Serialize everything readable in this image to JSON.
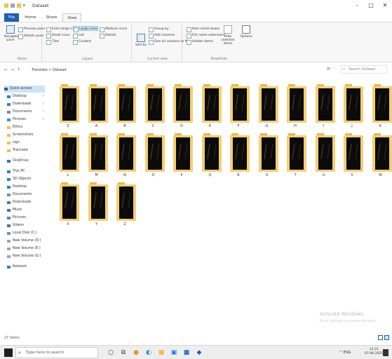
{
  "window": {
    "title": "Dataset",
    "controls": [
      "–",
      "□",
      "✕"
    ]
  },
  "ribbon": {
    "tabs": [
      "File",
      "Home",
      "Share",
      "View"
    ],
    "active_tab": "View",
    "groups": {
      "panes": {
        "name": "Panes",
        "items": [
          "Navigation pane",
          "Preview pane",
          "Details pane"
        ]
      },
      "layout": {
        "name": "Layout",
        "items": [
          "Extra large icons",
          "Large icons",
          "Medium icons",
          "Small icons",
          "List",
          "Details",
          "Tiles",
          "Content"
        ],
        "selected": "Large icons"
      },
      "current_view": {
        "name": "Current view",
        "sort_label": "Sort by",
        "items": [
          "Group by",
          "Add columns",
          "Size all columns to fit"
        ]
      },
      "show_hide": {
        "name": "Show/hide",
        "items": [
          "Item check boxes",
          "File name extensions",
          "Hidden items"
        ],
        "hide_selected": "Hide selected items",
        "options": "Options"
      }
    }
  },
  "address": {
    "path": "Translate > Dataset",
    "search_placeholder": "Search Dataset"
  },
  "nav": {
    "items": [
      {
        "label": "Quick access",
        "color": "#1a5fb4",
        "selected": true
      },
      {
        "label": "Desktop",
        "color": "#2b7fd6",
        "pinned": true
      },
      {
        "label": "Downloads",
        "color": "#2b7fd6",
        "pinned": true
      },
      {
        "label": "Documents",
        "color": "#7b8aa0",
        "pinned": true
      },
      {
        "label": "Pictures",
        "color": "#3a8fd8",
        "pinned": true
      },
      {
        "label": "Ethics",
        "color": "#f0c24e"
      },
      {
        "label": "Screenshots",
        "color": "#f0c24e"
      },
      {
        "label": "sign",
        "color": "#f0c24e"
      },
      {
        "label": "Translate",
        "color": "#f0c24e"
      },
      {
        "label": "OneDrive",
        "color": "#1a73e8",
        "gap": true
      },
      {
        "label": "This PC",
        "color": "#2b7fd6",
        "gap": true
      },
      {
        "label": "3D Objects",
        "color": "#2b7fd6"
      },
      {
        "label": "Desktop",
        "color": "#2b7fd6"
      },
      {
        "label": "Documents",
        "color": "#7b8aa0"
      },
      {
        "label": "Downloads",
        "color": "#2b7fd6"
      },
      {
        "label": "Music",
        "color": "#4a6fa5"
      },
      {
        "label": "Pictures",
        "color": "#3a8fd8"
      },
      {
        "label": "Videos",
        "color": "#4a6fa5"
      },
      {
        "label": "Local Disk (C:)",
        "color": "#7b8aa0"
      },
      {
        "label": "New Volume (D:)",
        "color": "#9aa4b0"
      },
      {
        "label": "New Volume (E:)",
        "color": "#9aa4b0"
      },
      {
        "label": "New Volume (G:)",
        "color": "#9aa4b0"
      },
      {
        "label": "Network",
        "color": "#2b7fd6",
        "gap": true
      }
    ]
  },
  "folders": [
    "Z",
    "A",
    "B",
    "C",
    "D",
    "E",
    "F",
    "G",
    "H",
    "I",
    "J",
    "K",
    "L",
    "M",
    "N",
    "O",
    "P",
    "Q",
    "R",
    "S",
    "T",
    "U",
    "V",
    "W",
    "X",
    "Y",
    "Z"
  ],
  "watermark": {
    "title": "Activate Windows",
    "subtitle": "Go to Settings to activate Windows."
  },
  "status": {
    "item_count": "27 items"
  },
  "taskbar": {
    "search_placeholder": "Type here to search",
    "apps": [
      {
        "icon": "cortana-icon",
        "glyph": "○",
        "color": "#333"
      },
      {
        "icon": "task-view-icon",
        "glyph": "⧉",
        "color": "#333"
      },
      {
        "icon": "chrome-icon",
        "glyph": "●",
        "color": "#e0a020"
      },
      {
        "icon": "edge-icon",
        "glyph": "◐",
        "color": "#1a8fd8"
      },
      {
        "icon": "file-explorer-icon",
        "glyph": "■",
        "color": "#f0c24e"
      },
      {
        "icon": "store-icon",
        "glyph": "▣",
        "color": "#1a73e8"
      },
      {
        "icon": "app-icon",
        "glyph": "■",
        "color": "#2b7fd6"
      },
      {
        "icon": "photos-icon",
        "glyph": "◆",
        "color": "#1a5fb4"
      }
    ],
    "tray_text": "^ ENG",
    "time": "13:31",
    "date": "07-06-2021"
  }
}
